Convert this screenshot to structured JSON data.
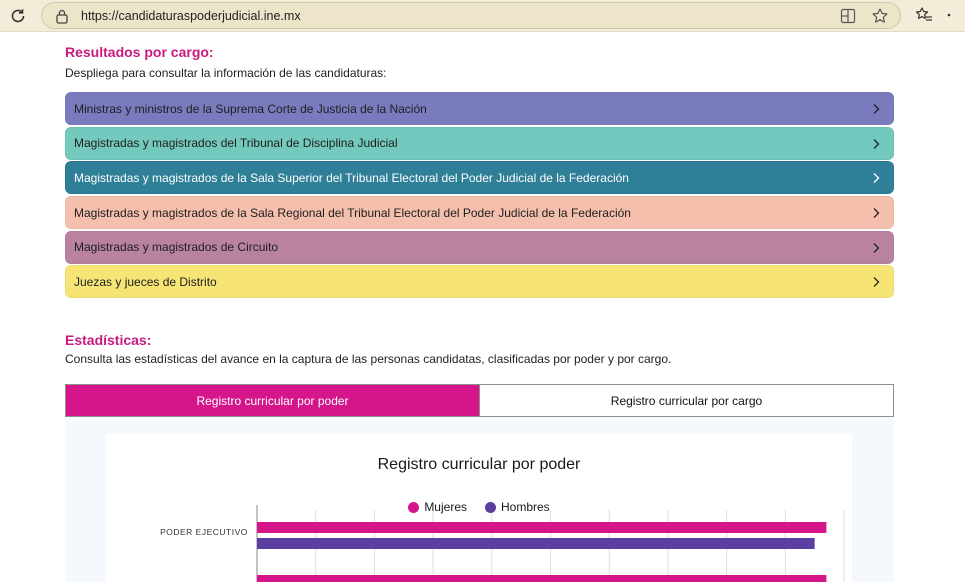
{
  "browser": {
    "url": "https://candidaturaspoderjudicial.ine.mx",
    "icons": [
      "reload-icon",
      "lock-icon",
      "split-screen-icon",
      "star-icon",
      "favorites-icon",
      "more-icon"
    ]
  },
  "resultados": {
    "title": "Resultados por cargo:",
    "description": "Despliega para consultar la información de las candidaturas:",
    "items": [
      {
        "label": "Ministras y ministros de la Suprema Corte de Justicia de la Nación",
        "color": "#7a7bbf"
      },
      {
        "label": "Magistradas y magistrados del Tribunal de Disciplina Judicial",
        "color": "#73c9bd"
      },
      {
        "label": "Magistradas y magistrados de la Sala Superior del Tribunal Electoral del Poder Judicial de la Federación",
        "color": "#2e7f97"
      },
      {
        "label": "Magistradas y magistrados de la Sala Regional del Tribunal Electoral del Poder Judicial de la Federación",
        "color": "#f5bfae"
      },
      {
        "label": "Magistradas y magistrados de Circuito",
        "color": "#b9839f"
      },
      {
        "label": "Juezas y jueces de Distrito",
        "color": "#f6e575"
      }
    ]
  },
  "estadisticas": {
    "title": "Estadísticas:",
    "description": "Consulta las estadísticas del avance en la captura de las personas candidatas, clasificadas por poder y por cargo.",
    "tabs": [
      {
        "label": "Registro curricular por poder",
        "active": true
      },
      {
        "label": "Registro curricular por cargo",
        "active": false
      }
    ]
  },
  "chart_data": {
    "type": "bar",
    "orientation": "horizontal",
    "title": "Registro curricular por poder",
    "categories": [
      "PODER EJECUTIVO",
      ""
    ],
    "series": [
      {
        "name": "Mujeres",
        "color": "#d4168a",
        "values": [
          0.97,
          0.97
        ]
      },
      {
        "name": "Hombres",
        "color": "#5b3fa0",
        "values": [
          0.95,
          null
        ]
      }
    ],
    "grid": true,
    "legend_position": "top"
  }
}
